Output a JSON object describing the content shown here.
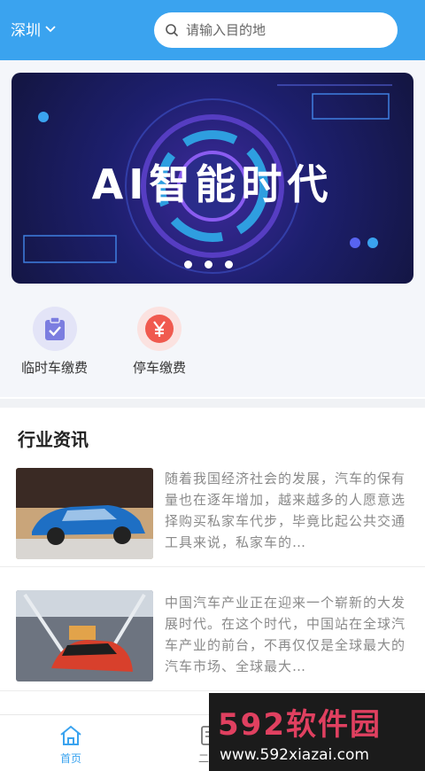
{
  "header": {
    "city": "深圳",
    "search_placeholder": "请输入目的地"
  },
  "banner": {
    "title": "AI智能时代",
    "pages": 3,
    "active_page": 1
  },
  "quick_actions": [
    {
      "label": "临时车缴费",
      "icon": "clipboard-check-icon",
      "color": "#7b7de0"
    },
    {
      "label": "停车缴费",
      "icon": "yen-icon",
      "color": "#f05a4f"
    }
  ],
  "news": {
    "title": "行业资讯",
    "items": [
      {
        "text": "随着我国经济社会的发展，汽车的保有量也在逐年增加，越来越多的人愿意选择购买私家车代步，毕竟比起公共交通工具来说，私家车的…"
      },
      {
        "text": "中国汽车产业正在迎来一个崭新的大发展时代。在这个时代，中国站在全球汽车产业的前台，不再仅仅是全球最大的汽车市场、全球最大…"
      }
    ]
  },
  "tabbar": {
    "home_label": "首页",
    "second_label": "二手"
  },
  "watermark": {
    "brand": "592软件园",
    "url": "www.592xiazai.com"
  },
  "colors": {
    "accent": "#3aa3ef"
  }
}
